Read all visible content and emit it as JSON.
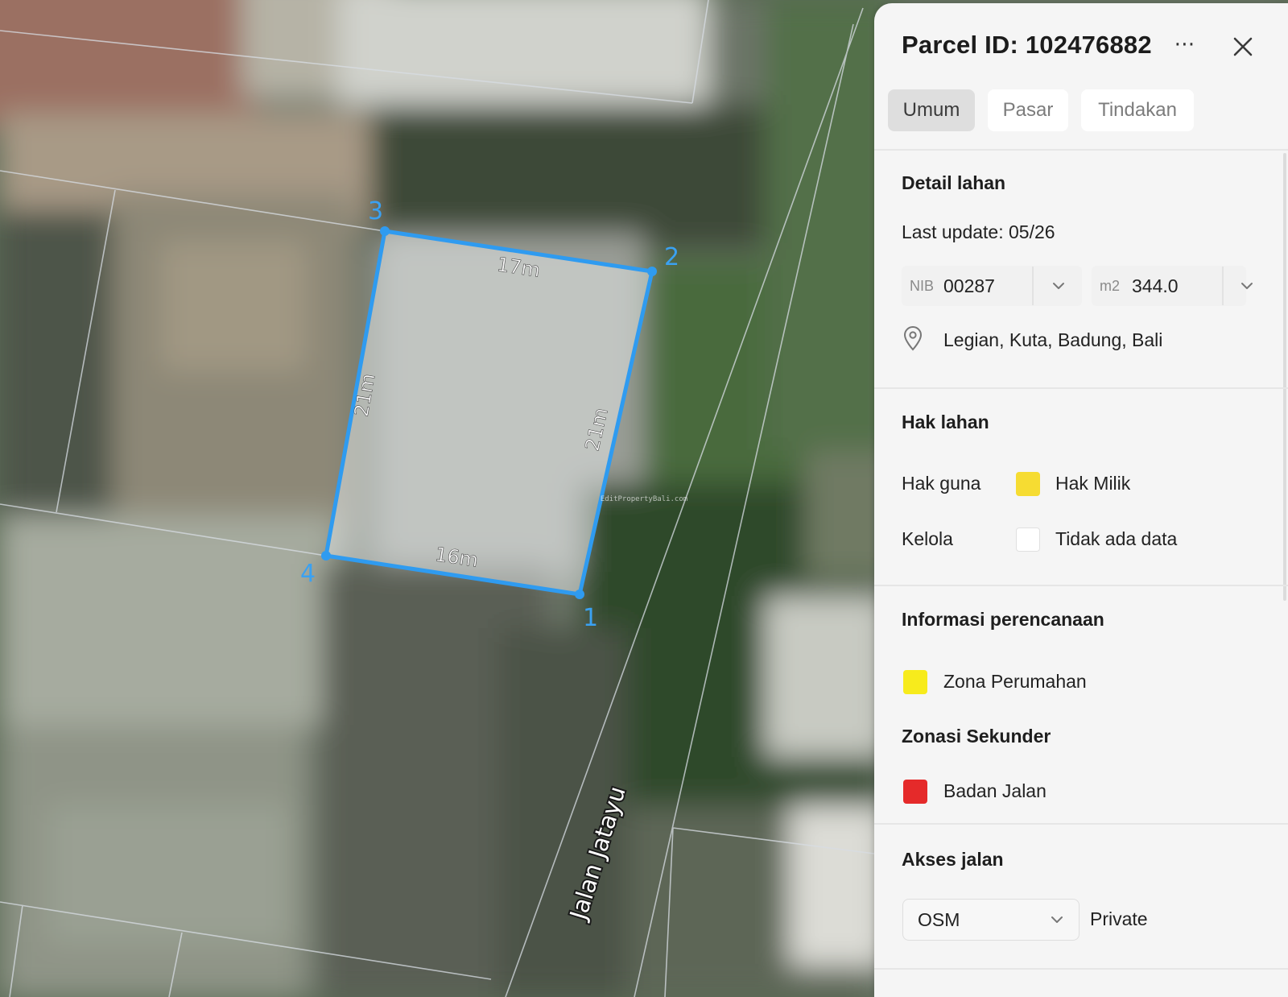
{
  "map": {
    "vertex_labels": [
      "1",
      "2",
      "3",
      "4"
    ],
    "edge_labels": {
      "edge_3_2": "17m",
      "edge_2_1": "21m",
      "edge_4_1": "16m",
      "edge_3_4": "21m"
    },
    "road_label": "Jalan Jatayu",
    "watermark": "EditPropertyBali.com",
    "colors": {
      "parcel_outline": "#2f9bf0",
      "parcel_fill": "rgba(225,230,230,0.55)"
    }
  },
  "panel": {
    "title": "Parcel ID: 102476882",
    "more_icon": "⋯",
    "tabs": [
      {
        "label": "Umum",
        "active": true
      },
      {
        "label": "Pasar",
        "active": false
      },
      {
        "label": "Tindakan",
        "active": false
      }
    ],
    "detail": {
      "heading": "Detail lahan",
      "last_update": "Last update: 05/26",
      "nib_prefix": "NIB",
      "nib_value": "00287",
      "area_prefix": "m2",
      "area_value": "344.0",
      "location": "Legian, Kuta, Badung, Bali"
    },
    "rights": {
      "heading": "Hak lahan",
      "rows": [
        {
          "label": "Hak guna",
          "value": "Hak Milik",
          "color": "#f6dc32"
        },
        {
          "label": "Kelola",
          "value": "Tidak ada data",
          "color": "#ffffff"
        }
      ]
    },
    "planning": {
      "heading": "Informasi perencanaan",
      "primary": {
        "value": "Zona Perumahan",
        "color": "#f7eb1c"
      },
      "secondary_heading": "Zonasi Sekunder",
      "secondary": {
        "value": "Badan Jalan",
        "color": "#e52a2a"
      }
    },
    "road_access": {
      "heading": "Akses jalan",
      "source_selected": "OSM",
      "access_value": "Private"
    }
  }
}
